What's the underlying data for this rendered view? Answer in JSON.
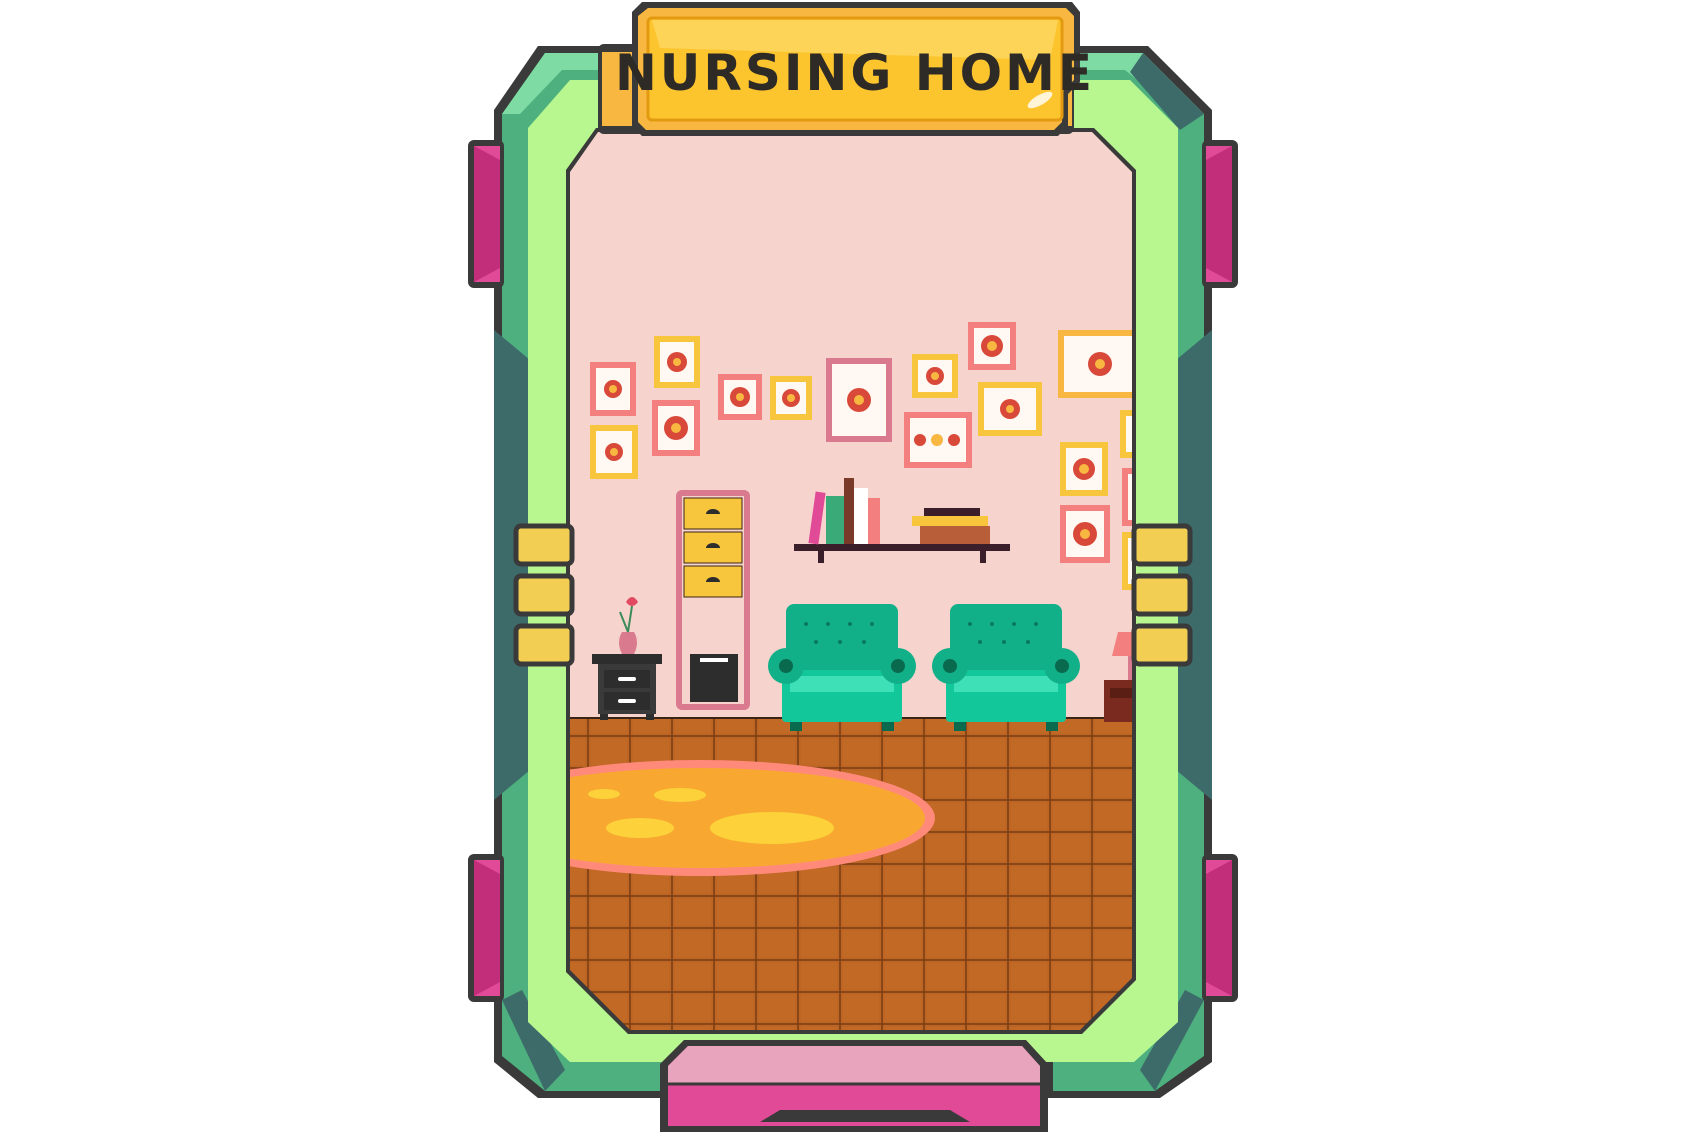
{
  "card": {
    "title": "NURSING HOME"
  },
  "colors": {
    "frame_outer": "#4db07e",
    "frame_inner": "#b8f78f",
    "frame_dark": "#3d6b6a",
    "gem": "#e14a96",
    "banner": "#fcc52e",
    "wall": "#f6d3cd",
    "floor": "#b85f20",
    "rug": "#f8a830",
    "armchair": "#12c89b"
  },
  "icons": {
    "picture_frame": "flower-picture-icon",
    "books": "book-icon",
    "vase": "tulip-vase-icon"
  }
}
